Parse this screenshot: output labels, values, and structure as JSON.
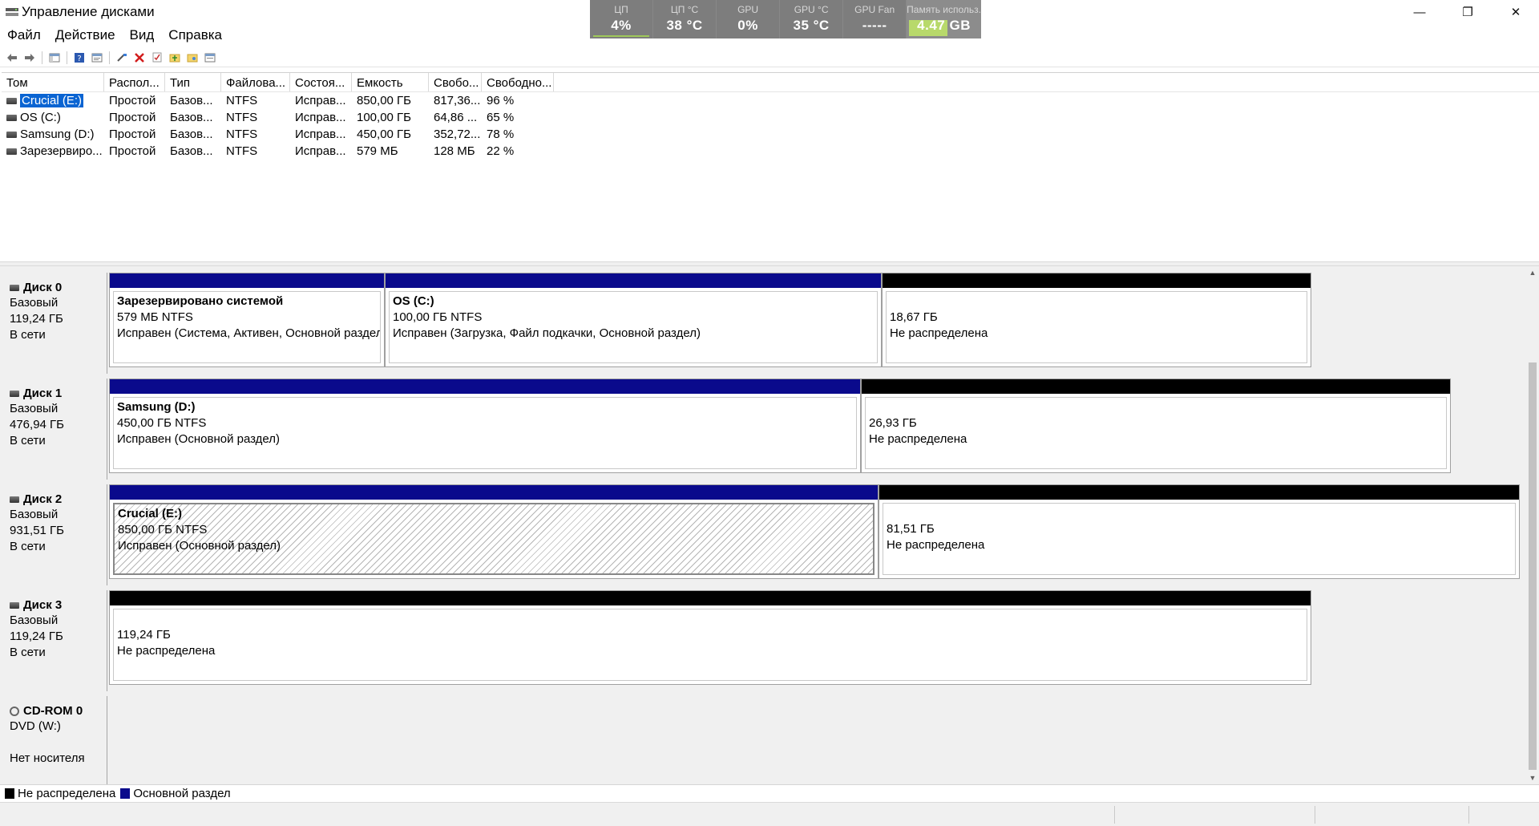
{
  "window": {
    "title": "Управление дисками",
    "minimize_glyph": "—",
    "restore_glyph": "❐",
    "close_glyph": "✕"
  },
  "monitor": [
    {
      "label": "ЦП",
      "value": "4%"
    },
    {
      "label": "ЦП °C",
      "value": "38 °C"
    },
    {
      "label": "GPU",
      "value": "0%"
    },
    {
      "label": "GPU °C",
      "value": "35 °C"
    },
    {
      "label": "GPU Fan",
      "value": "-----"
    },
    {
      "label": "Память использ.",
      "value": "4.47 GB",
      "fill_fraction": 0.52
    }
  ],
  "menu": [
    "Файл",
    "Действие",
    "Вид",
    "Справка"
  ],
  "toolbar_icons": [
    "back-icon",
    "forward-icon",
    "console-tree-icon",
    "help-icon",
    "properties-icon",
    "connect-icon",
    "delete-icon",
    "check-icon",
    "new-folder-icon",
    "open-folder-icon",
    "list-icon"
  ],
  "volumes": {
    "columns": [
      "Том",
      "Распол...",
      "Тип",
      "Файлова...",
      "Состоя...",
      "Емкость",
      "Свобо...",
      "Свободно..."
    ],
    "rows": [
      [
        "Crucial (E:)",
        "Простой",
        "Базов...",
        "NTFS",
        "Исправ...",
        "850,00 ГБ",
        "817,36...",
        "96 %"
      ],
      [
        "OS (C:)",
        "Простой",
        "Базов...",
        "NTFS",
        "Исправ...",
        "100,00 ГБ",
        "64,86 ...",
        "65 %"
      ],
      [
        "Samsung (D:)",
        "Простой",
        "Базов...",
        "NTFS",
        "Исправ...",
        "450,00 ГБ",
        "352,72...",
        "78 %"
      ],
      [
        "Зарезервиро...",
        "Простой",
        "Базов...",
        "NTFS",
        "Исправ...",
        "579 МБ",
        "128 МБ",
        "22 %"
      ]
    ]
  },
  "disks": [
    {
      "name": "Диск 0",
      "type": "Базовый",
      "size": "119,24 ГБ",
      "status": "В сети",
      "partitions": [
        {
          "kind": "primary",
          "name": "Зарезервировано системой",
          "size": "579 МБ NTFS",
          "status": "Исправен (Система, Активен, Основной раздел)"
        },
        {
          "kind": "primary",
          "name": "OS  (C:)",
          "size": "100,00 ГБ NTFS",
          "status": "Исправен (Загрузка, Файл подкачки, Основной раздел)"
        },
        {
          "kind": "unalloc",
          "name": "",
          "size": "18,67 ГБ",
          "status": "Не распределена"
        }
      ]
    },
    {
      "name": "Диск 1",
      "type": "Базовый",
      "size": "476,94 ГБ",
      "status": "В сети",
      "partitions": [
        {
          "kind": "primary",
          "name": "Samsung  (D:)",
          "size": "450,00 ГБ NTFS",
          "status": "Исправен (Основной раздел)"
        },
        {
          "kind": "unalloc",
          "name": "",
          "size": "26,93 ГБ",
          "status": "Не распределена"
        }
      ]
    },
    {
      "name": "Диск 2",
      "type": "Базовый",
      "size": "931,51 ГБ",
      "status": "В сети",
      "partitions": [
        {
          "kind": "primary",
          "name": "Crucial  (E:)",
          "size": "850,00 ГБ NTFS",
          "status": "Исправен (Основной раздел)",
          "selected": true
        },
        {
          "kind": "unalloc",
          "name": "",
          "size": "81,51 ГБ",
          "status": "Не распределена"
        }
      ]
    },
    {
      "name": "Диск 3",
      "type": "Базовый",
      "size": "119,24 ГБ",
      "status": "В сети",
      "partitions": [
        {
          "kind": "unalloc",
          "name": "",
          "size": "119,24 ГБ",
          "status": "Не распределена"
        }
      ]
    }
  ],
  "cdrom": {
    "name": "CD-ROM 0",
    "drive": "DVD (W:)",
    "status": "Нет носителя"
  },
  "legend": [
    {
      "label": "Не распределена",
      "color": "#000000"
    },
    {
      "label": "Основной раздел",
      "color": "#0a0a8c"
    }
  ]
}
